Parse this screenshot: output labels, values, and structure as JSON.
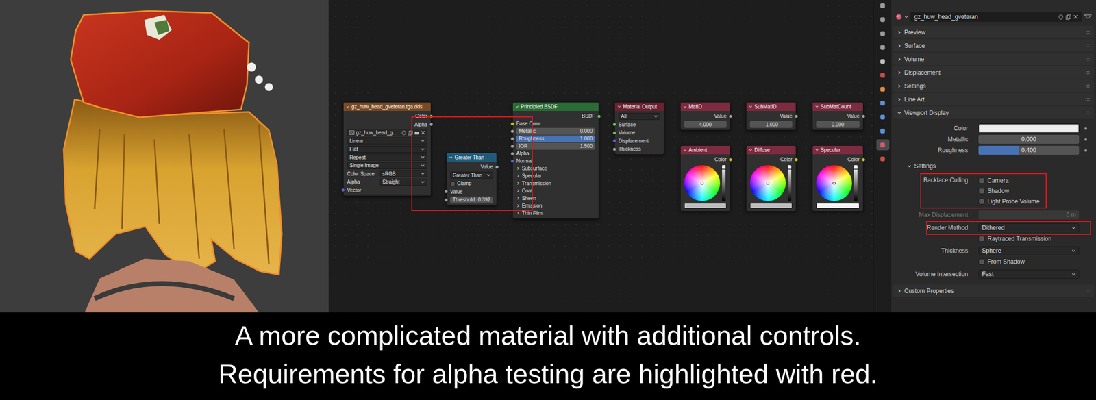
{
  "highlight_color": "#e0161b",
  "viewport": {
    "object_selected": true
  },
  "node_editor": {
    "nodes": [
      {
        "kind": "texture",
        "title": "gz_huw_head_gveteran.tga.dds",
        "rows": [
          {
            "kind": "output",
            "label": "Color",
            "color": "#c7c729"
          },
          {
            "kind": "output",
            "label": "Alpha",
            "color": "#a1a1a1"
          },
          {
            "kind": "image",
            "value": "gz_huw_head_g..."
          },
          {
            "kind": "dropdown",
            "value": "Linear"
          },
          {
            "kind": "dropdown",
            "value": "Flat"
          },
          {
            "kind": "dropdown",
            "value": "Repeat"
          },
          {
            "kind": "dropdown",
            "value": "Single Image"
          },
          {
            "kind": "dropdown",
            "label": "Color Space",
            "value": "sRGB"
          },
          {
            "kind": "dropdown",
            "label": "Alpha",
            "value": "Straight"
          },
          {
            "kind": "input",
            "label": "Vector",
            "color": "#6363c7"
          }
        ]
      },
      {
        "kind": "converter",
        "title": "Greater Than",
        "rows": [
          {
            "kind": "output",
            "label": "Value",
            "color": "#a1a1a1"
          },
          {
            "kind": "dropdown",
            "value": "Greater Than"
          },
          {
            "kind": "checkbox",
            "label": "Clamp",
            "checked": false
          },
          {
            "kind": "input",
            "label": "Value",
            "color": "#a1a1a1"
          },
          {
            "kind": "value",
            "label": "Threshold",
            "value": "0.392",
            "color": "#a1a1a1"
          }
        ]
      },
      {
        "kind": "shader",
        "title": "Principled BSDF",
        "rows": [
          {
            "kind": "output",
            "label": "BSDF",
            "color": "#63c763"
          },
          {
            "kind": "input",
            "label": "Base Color",
            "color": "#c7c729"
          },
          {
            "kind": "value",
            "label": "Metallic",
            "value": "0.000",
            "level": 0,
            "color": "#a1a1a1"
          },
          {
            "kind": "value",
            "label": "Roughness",
            "value": "1.000",
            "level": 1,
            "color": "#a1a1a1"
          },
          {
            "kind": "value",
            "label": "IOR",
            "value": "1.500",
            "color": "#a1a1a1"
          },
          {
            "kind": "input",
            "label": "Alpha",
            "color": "#a1a1a1"
          },
          {
            "kind": "input",
            "label": "Normal",
            "color": "#6363c7"
          },
          {
            "kind": "panel",
            "label": "Subsurface",
            "expanded": false
          },
          {
            "kind": "panel",
            "label": "Specular",
            "expanded": false
          },
          {
            "kind": "panel",
            "label": "Transmission",
            "expanded": false
          },
          {
            "kind": "panel",
            "label": "Coat",
            "expanded": false
          },
          {
            "kind": "panel",
            "label": "Sheen",
            "expanded": false
          },
          {
            "kind": "panel",
            "label": "Emission",
            "expanded": false
          },
          {
            "kind": "panel",
            "label": "Thin Film",
            "expanded": false
          }
        ]
      },
      {
        "kind": "output",
        "title": "Material Output",
        "rows": [
          {
            "kind": "dropdown",
            "value": "All"
          },
          {
            "kind": "input",
            "label": "Surface",
            "color": "#63c763"
          },
          {
            "kind": "input",
            "label": "Volume",
            "color": "#63c763"
          },
          {
            "kind": "input",
            "label": "Displacement",
            "color": "#6363c7"
          },
          {
            "kind": "input",
            "label": "Thickness",
            "color": "#a1a1a1"
          }
        ]
      },
      {
        "kind": "input",
        "title": "MatID",
        "rows": [
          {
            "kind": "output",
            "label": "Value",
            "color": "#a1a1a1"
          },
          {
            "kind": "value",
            "value": "4.000"
          }
        ]
      },
      {
        "kind": "input",
        "title": "SubMatID",
        "rows": [
          {
            "kind": "output",
            "label": "Value",
            "color": "#a1a1a1"
          },
          {
            "kind": "value",
            "value": "-1.000"
          }
        ]
      },
      {
        "kind": "input",
        "title": "SubMatCount",
        "rows": [
          {
            "kind": "output",
            "label": "Value",
            "color": "#a1a1a1"
          },
          {
            "kind": "value",
            "value": "0.000"
          }
        ]
      },
      {
        "kind": "input",
        "title": "Ambient",
        "rows": [
          {
            "kind": "output",
            "label": "Color",
            "color": "#c7c729"
          },
          {
            "kind": "colorwheel",
            "color": "#bdbdbd"
          }
        ]
      },
      {
        "kind": "input",
        "title": "Diffuse",
        "rows": [
          {
            "kind": "output",
            "label": "Color",
            "color": "#c7c729"
          },
          {
            "kind": "colorwheel",
            "color": "#bdbdbd"
          }
        ]
      },
      {
        "kind": "input",
        "title": "Specular",
        "rows": [
          {
            "kind": "output",
            "label": "Color",
            "color": "#c7c729"
          },
          {
            "kind": "colorwheel",
            "color": "#f4f4f4"
          }
        ]
      }
    ],
    "links": [
      {
        "from_node": 0,
        "from_row": 0,
        "to_node": 2,
        "to_row": 1
      },
      {
        "from_node": 0,
        "from_row": 1,
        "to_node": 1,
        "to_row": 3
      },
      {
        "from_node": 1,
        "from_row": 0,
        "to_node": 2,
        "to_row": 5
      },
      {
        "from_node": 2,
        "from_row": 0,
        "to_node": 3,
        "to_row": 1
      }
    ]
  },
  "properties": {
    "tabs": [
      {
        "selected": false
      },
      {
        "selected": false
      },
      {
        "selected": false
      },
      {
        "selected": false
      },
      {
        "selected": false
      },
      {
        "selected": false
      },
      {
        "selected": false
      },
      {
        "selected": false
      },
      {
        "selected": false
      },
      {
        "selected": false
      },
      {
        "selected": true
      },
      {
        "selected": false
      }
    ],
    "material_name": "gz_huw_head_gveteran",
    "sections": [
      {
        "label": "Preview",
        "expanded": false
      },
      {
        "label": "Surface",
        "expanded": false
      },
      {
        "label": "Volume",
        "expanded": false
      },
      {
        "label": "Displacement",
        "expanded": false
      },
      {
        "label": "Settings",
        "expanded": false
      },
      {
        "label": "Line Art",
        "expanded": false
      },
      {
        "label": "Viewport Display",
        "expanded": true
      },
      {
        "label": "Custom Properties",
        "expanded": false
      }
    ],
    "viewport_display": {
      "rows": [
        {
          "kind": "color",
          "label": "Color",
          "color": "#eeeeee"
        },
        {
          "kind": "slider",
          "label": "Metallic",
          "value": "0.000",
          "level": 0
        },
        {
          "kind": "slider",
          "label": "Roughness",
          "value": "0.400",
          "level": 0.4
        }
      ],
      "settings": {
        "label": "Settings",
        "expanded": true,
        "rows": [
          {
            "kind": "checkgroup",
            "label": "Backface Culling",
            "highlighted": true,
            "items": [
              {
                "label": "Camera",
                "checked": false
              },
              {
                "label": "Shadow",
                "checked": false
              },
              {
                "label": "Light Probe Volume",
                "checked": false
              }
            ]
          },
          {
            "kind": "field",
            "label": "Max Displacement",
            "value": "0 m",
            "disabled": true,
            "highlighted": false
          },
          {
            "kind": "dropdown",
            "label": "Render Method",
            "value": "Dithered",
            "highlighted": true
          },
          {
            "kind": "checkbox",
            "label": "Raytraced Transmission",
            "checked": false,
            "highlighted": false
          },
          {
            "kind": "dropdown",
            "label": "Thickness",
            "value": "Sphere",
            "highlighted": false
          },
          {
            "kind": "checkbox",
            "label": "From Shadow",
            "checked": false,
            "highlighted": false
          },
          {
            "kind": "dropdown",
            "label": "Volume Intersection",
            "value": "Fast",
            "highlighted": false
          }
        ]
      }
    }
  },
  "caption": [
    "A more complicated material with additional controls.",
    "Requirements for alpha testing are highlighted with red."
  ]
}
